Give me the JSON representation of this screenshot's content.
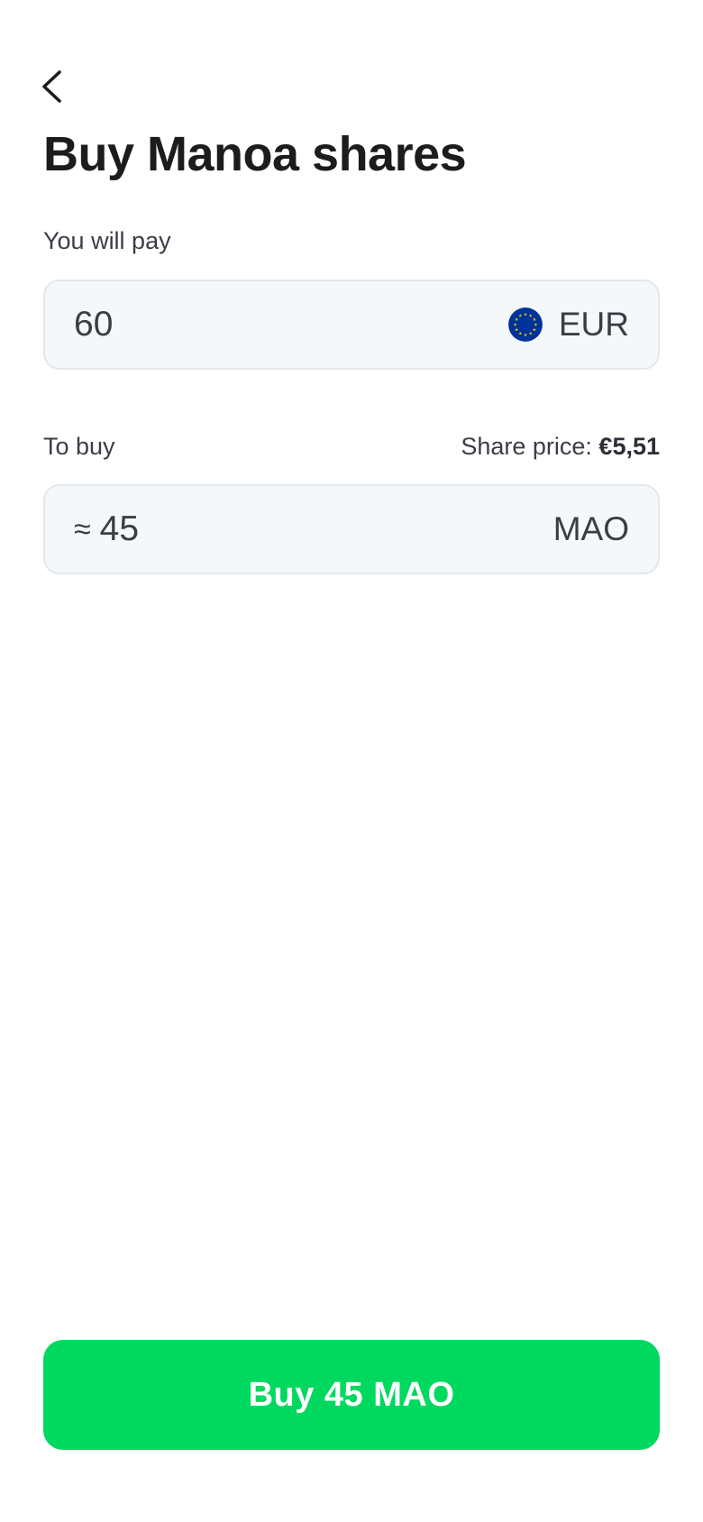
{
  "header": {
    "back_icon": "chevron-left-icon",
    "title": "Buy Manoa shares"
  },
  "pay": {
    "label": "You will pay",
    "amount": "60",
    "currency_code": "EUR",
    "currency_icon": "eu-flag-icon"
  },
  "buy": {
    "label": "To buy",
    "share_price_label": "Share price:",
    "share_price_value": "€5,51",
    "approx_symbol": "≈",
    "amount": "45",
    "ticker": "MAO"
  },
  "cta": {
    "label": "Buy 45 MAO"
  },
  "colors": {
    "accent": "#00d95f",
    "field_background": "#f4f8fb",
    "field_border": "#e3e7ec",
    "eu_blue": "#003399",
    "eu_yellow": "#ffcc00"
  }
}
